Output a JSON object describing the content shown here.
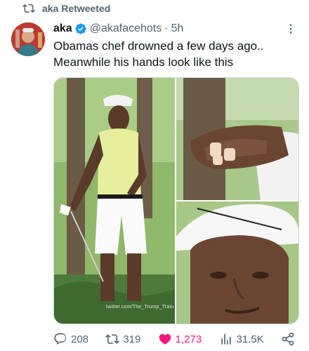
{
  "retweet_header": {
    "text": "aka Retweeted",
    "icon": "retweet-icon"
  },
  "tweet": {
    "author_name": "aka",
    "verified": true,
    "handle": "@akafacehots",
    "separator": "·",
    "time": "5h",
    "text_lines": [
      "Obamas chef drowned a few days ago..",
      "Meanwhile his hands look like this"
    ],
    "media": {
      "watermark": "twitter.com/The_Trump_Train"
    }
  },
  "actions": {
    "replies": "208",
    "retweets": "319",
    "likes": "1,273",
    "views": "31.5K"
  },
  "colors": {
    "text_primary": "#0f1419",
    "text_secondary": "#536471",
    "verified": "#1d9bf0",
    "like": "#f91880",
    "border": "#cfd9de"
  }
}
